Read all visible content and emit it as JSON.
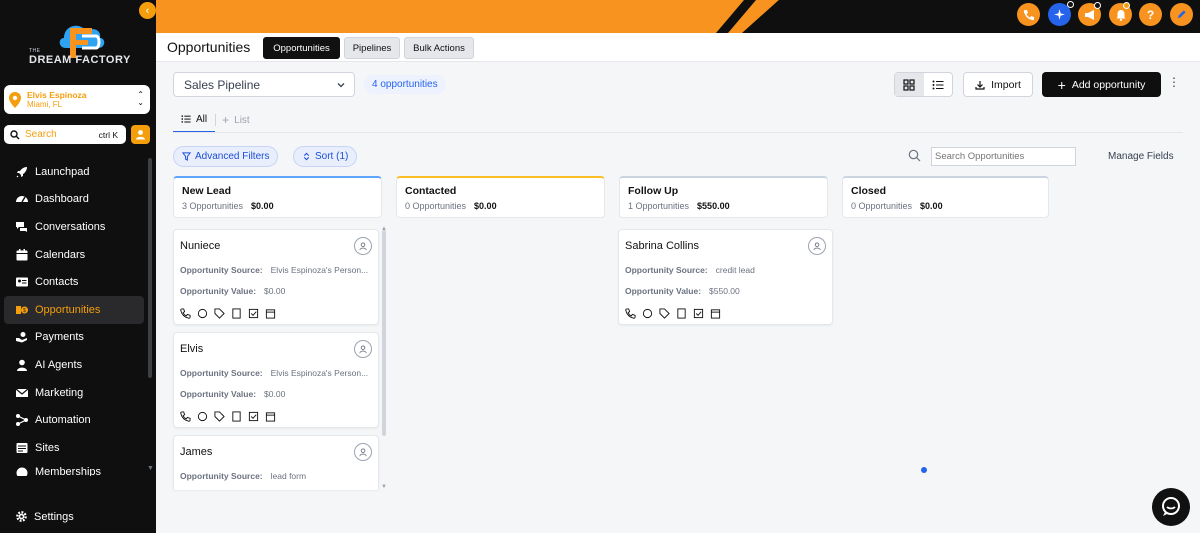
{
  "brand": {
    "line1": "THE",
    "line2": "DREAM FACTORY"
  },
  "location": {
    "name": "Elvis Espinoza",
    "city": "Miami, FL"
  },
  "search": {
    "placeholder": "Search",
    "shortcut": "ctrl K"
  },
  "nav": [
    {
      "label": "Launchpad",
      "icon": "rocket-icon"
    },
    {
      "label": "Dashboard",
      "icon": "dashboard-icon"
    },
    {
      "label": "Conversations",
      "icon": "chat-icon"
    },
    {
      "label": "Calendars",
      "icon": "calendar-icon"
    },
    {
      "label": "Contacts",
      "icon": "contacts-icon"
    },
    {
      "label": "Opportunities",
      "icon": "opportunities-icon",
      "active": true
    },
    {
      "label": "Payments",
      "icon": "payments-icon"
    },
    {
      "label": "AI Agents",
      "icon": "ai-agents-icon"
    },
    {
      "label": "Marketing",
      "icon": "marketing-icon"
    },
    {
      "label": "Automation",
      "icon": "automation-icon"
    },
    {
      "label": "Sites",
      "icon": "sites-icon"
    },
    {
      "label": "Memberships",
      "icon": "memberships-icon"
    }
  ],
  "settings_label": "Settings",
  "header": {
    "title": "Opportunities",
    "tabs": [
      "Opportunities",
      "Pipelines",
      "Bulk Actions"
    ]
  },
  "toolbar": {
    "pipeline": "Sales Pipeline",
    "count": "4 opportunities",
    "import": "Import",
    "add": "Add opportunity"
  },
  "view_tabs": {
    "all": "All",
    "list": "List"
  },
  "filters": {
    "advanced": "Advanced Filters",
    "sort": "Sort (1)"
  },
  "search_opps": {
    "placeholder": "Search Opportunities"
  },
  "manage_fields": "Manage Fields",
  "columns": [
    {
      "title": "New Lead",
      "count": "3 Opportunities",
      "value": "$0.00",
      "color": "#60a5fa"
    },
    {
      "title": "Contacted",
      "count": "0 Opportunities",
      "value": "$0.00",
      "color": "#fbbf24"
    },
    {
      "title": "Follow Up",
      "count": "1 Opportunities",
      "value": "$550.00",
      "color": "#cbd5e1"
    },
    {
      "title": "Closed",
      "count": "0 Opportunities",
      "value": "$0.00",
      "color": "#cbd5e1"
    }
  ],
  "cards": [
    {
      "name": "Nuniece",
      "source_label": "Opportunity Source:",
      "source": "Elvis Espinoza's Person...",
      "value_label": "Opportunity Value:",
      "value": "$0.00"
    },
    {
      "name": "Elvis",
      "source_label": "Opportunity Source:",
      "source": "Elvis Espinoza's Person...",
      "value_label": "Opportunity Value:",
      "value": "$0.00"
    },
    {
      "name": "James",
      "source_label": "Opportunity Source:",
      "source": "lead form"
    },
    {
      "name": "Sabrina Collins",
      "source_label": "Opportunity Source:",
      "source": "credit lead",
      "value_label": "Opportunity Value:",
      "value": "$550.00"
    }
  ],
  "colors": {
    "accent": "#f7931e",
    "primary": "#2563eb",
    "sidebar": "#0f0f10"
  }
}
